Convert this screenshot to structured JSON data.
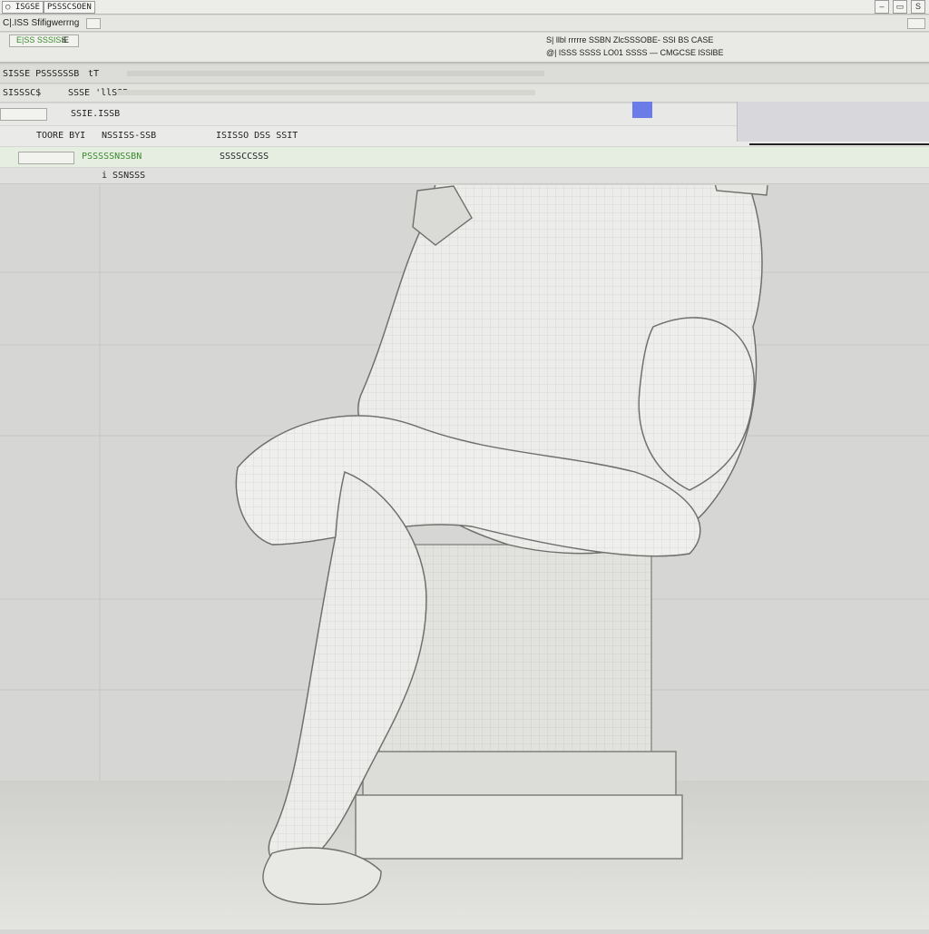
{
  "titlebar": {
    "tab_1": "○ ISGSE",
    "tab_2": "PSSSCSOEN"
  },
  "menubar": {
    "title": "C|.ISS Sfifigwerrng"
  },
  "toolbar": {
    "field_label": "E|SS SSSISS",
    "field_suffix": "iE",
    "status_line_1": "S|  llbl  rrrrre SSBN  ZlcSSSOBE-  SSI  BS   CASE",
    "status_line_2": "@|  lSSS  SSSS LO01 SSSS   —    CMGCSE  lSSlBE"
  },
  "list_header": {
    "col_1": "SISSE  PSSSSSSB",
    "col_2": "tT"
  },
  "list_subheader": {
    "col_1": "SISSSC$",
    "col_2": "SSSE 'llSSB"
  },
  "rows": {
    "r1_label": "SSIE.ISSB",
    "r2_col_1": "TOORE  BYI",
    "r2_col_2": "NSSISS-SSB",
    "r2_col_3": "ISISSO  DSS  SSIT",
    "r3_col_1": "PSSSSSNSSBN",
    "r3_col_2": "SSSSCCSSS",
    "r4_col_1": "i  SSNSSS"
  },
  "colors": {
    "accent_green": "#3b8a2d",
    "accent_blue": "#2a49b8",
    "highlight_blue": "#6b7be8"
  },
  "icons": {
    "minimize": "minimize-icon",
    "maximize": "maximize-icon",
    "close": "close-icon"
  }
}
